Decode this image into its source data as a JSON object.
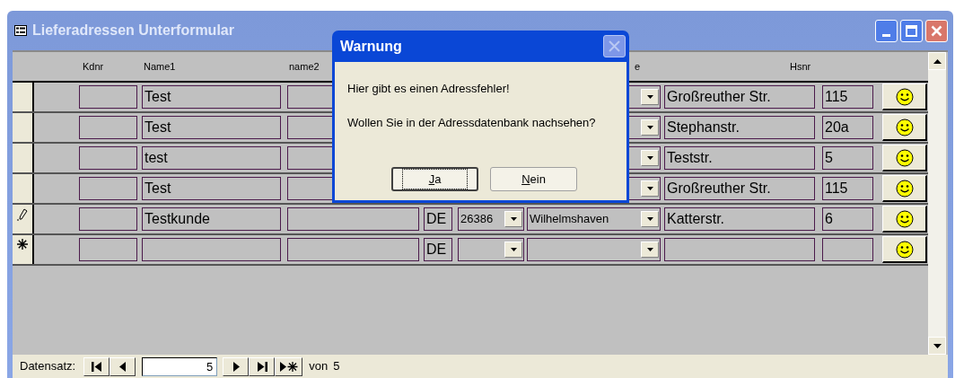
{
  "window": {
    "title": "Lieferadressen Unterformular"
  },
  "header": {
    "kdnr": "Kdnr",
    "name1": "Name1",
    "name2": "name2",
    "column_4": "e",
    "hsnr": "Hsnr"
  },
  "rows": [
    {
      "kind": "record",
      "name1": "Test",
      "street": "Großreuther Str.",
      "hsnr": "115"
    },
    {
      "kind": "record",
      "name1": "Test",
      "street": "Stephanstr.",
      "hsnr": "20a"
    },
    {
      "kind": "record",
      "name1": "test",
      "street": "Teststr.",
      "hsnr": "5"
    },
    {
      "kind": "record",
      "name1": "Test",
      "street": "Großreuther Str.",
      "hsnr": "115"
    },
    {
      "kind": "editing",
      "name1": "Testkunde",
      "country": "DE",
      "plz": "26386",
      "city": "Wilhelmshaven",
      "street": "Katterstr.",
      "hsnr": "6"
    },
    {
      "kind": "new",
      "country": "DE"
    }
  ],
  "navigation": {
    "label": "Datensatz:",
    "current": "5",
    "of_label": "von",
    "total": "5"
  },
  "dialog": {
    "title": "Warnung",
    "lines": [
      "Hier gibt es einen Adressfehler!",
      "Wollen Sie in der Adressdatenbank nachsehen?"
    ],
    "buttons": [
      {
        "label": "Ja",
        "focused": true
      },
      {
        "label": "Nein",
        "focused": false
      }
    ]
  }
}
